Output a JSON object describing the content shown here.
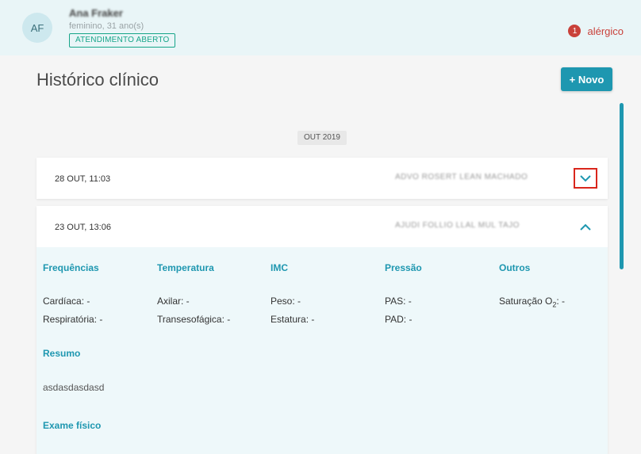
{
  "patient": {
    "initials": "AF",
    "name": "Ana Fraker",
    "info": "feminino, 31 ano(s)",
    "status": "ATENDIMENTO ABERTO"
  },
  "allergy": {
    "count": "1",
    "label": "alérgico"
  },
  "page": {
    "title": "Histórico clínico",
    "new_button": "+ Novo"
  },
  "timeline": {
    "month": "OUT 2019",
    "entries": [
      {
        "date": "28 OUT, 11:03",
        "author": "ADVO ROSERT LEAN MACHADO",
        "expanded": false
      },
      {
        "date": "23 OUT, 13:06",
        "author": "AJUDI FOLLIO LLAL MUL TAJO",
        "expanded": true
      }
    ]
  },
  "vitals": {
    "frequencias": {
      "title": "Frequências",
      "cardiaca": "Cardíaca: -",
      "respiratoria": "Respiratória: -"
    },
    "temperatura": {
      "title": "Temperatura",
      "axilar": "Axilar: -",
      "transesofagica": "Transesofágica: -"
    },
    "imc": {
      "title": "IMC",
      "peso": "Peso: -",
      "estatura": "Estatura: -"
    },
    "pressao": {
      "title": "Pressão",
      "pas": "PAS: -",
      "pad": "PAD: -"
    },
    "outros": {
      "title": "Outros",
      "saturacao": "Saturação O",
      "saturacao_sub": "2",
      "saturacao_value": ": -"
    }
  },
  "resumo": {
    "title": "Resumo",
    "text": "asdasdasdasd"
  },
  "exame": {
    "title": "Exame físico"
  },
  "colors": {
    "accent": "#1e97b0",
    "danger": "#c9413a",
    "success": "#17a589"
  }
}
